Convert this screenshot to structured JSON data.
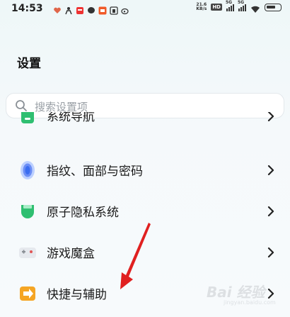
{
  "status_bar": {
    "time": "14:53",
    "net_speed_value": "21.6",
    "net_speed_unit": "KB/s",
    "hd_label": "HD",
    "sim1_label": "5G",
    "sim2_label": "5G"
  },
  "header": {
    "title": "设置"
  },
  "search": {
    "placeholder": "搜索设置项"
  },
  "settings_list": [
    {
      "label": "系统导航",
      "icon": "navigation-icon",
      "partial": true
    },
    {
      "label": "指纹、面部与密码",
      "icon": "fingerprint-icon"
    },
    {
      "label": "原子隐私系统",
      "icon": "privacy-icon"
    },
    {
      "label": "游戏魔盒",
      "icon": "game-box-icon"
    },
    {
      "label": "快捷与辅助",
      "icon": "shortcut-icon"
    }
  ],
  "colors": {
    "accent_blue": "#3a6df0",
    "privacy_green": "#2fbf71",
    "shortcut_orange": "#f5a524",
    "annotation_red": "#e02020"
  },
  "watermark": {
    "text": "Bai 经验",
    "sub": "jingyan.baidu.com"
  }
}
